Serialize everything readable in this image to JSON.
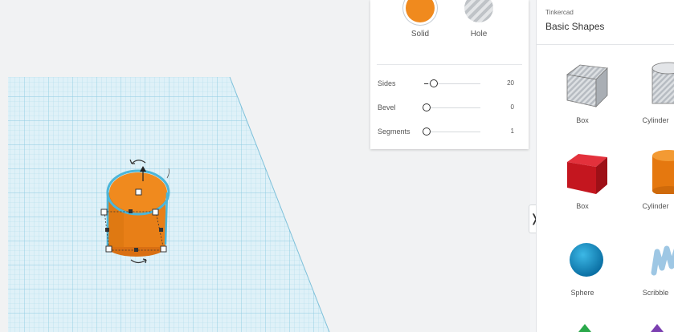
{
  "inspector": {
    "modes": [
      {
        "label": "Solid",
        "color": "#f08a1e",
        "selected": true
      },
      {
        "label": "Hole",
        "color": "#c9cccf",
        "selected": false
      }
    ],
    "params": [
      {
        "label": "Sides",
        "value": "20"
      },
      {
        "label": "Bevel",
        "value": "0"
      },
      {
        "label": "Segments",
        "value": "1"
      }
    ]
  },
  "shapes_panel": {
    "brand": "Tinkercad",
    "library": "Basic Shapes",
    "shapes": [
      {
        "label": "Box",
        "icon": "box-striped-icon"
      },
      {
        "label": "Cylinder",
        "icon": "cylinder-striped-icon"
      },
      {
        "label": "Box",
        "icon": "box-red-icon"
      },
      {
        "label": "Cylinder",
        "icon": "cylinder-orange-icon"
      },
      {
        "label": "Sphere",
        "icon": "sphere-blue-icon"
      },
      {
        "label": "Scribble",
        "icon": "scribble-icon"
      }
    ]
  },
  "workplane": {
    "object": "cylinder",
    "object_color": "#f08a1e",
    "selection_outline_color": "#4db6d8",
    "grid_color": "#a9d9ea"
  },
  "toggle": {
    "glyph": "❭"
  }
}
